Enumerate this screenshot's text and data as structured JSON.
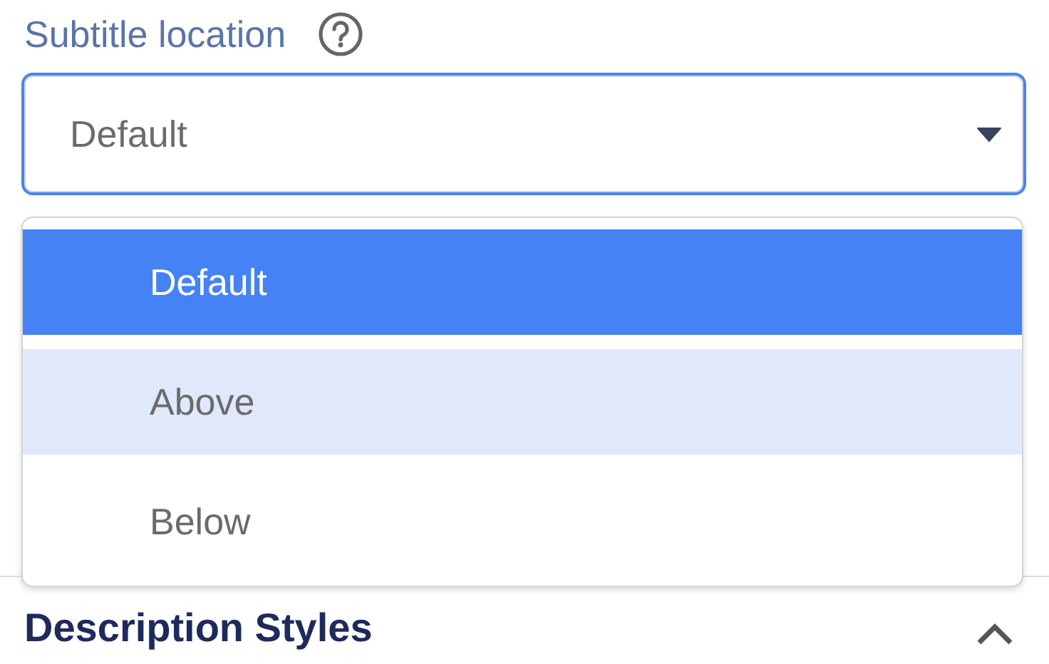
{
  "field": {
    "label": "Subtitle location",
    "value": "Default",
    "expanded": true
  },
  "options": [
    {
      "label": "Default",
      "selected": true,
      "highlighted": false
    },
    {
      "label": "Above",
      "selected": false,
      "highlighted": true
    },
    {
      "label": "Below",
      "selected": false,
      "highlighted": false
    }
  ],
  "section": {
    "title": "Description Styles",
    "expanded": true
  }
}
